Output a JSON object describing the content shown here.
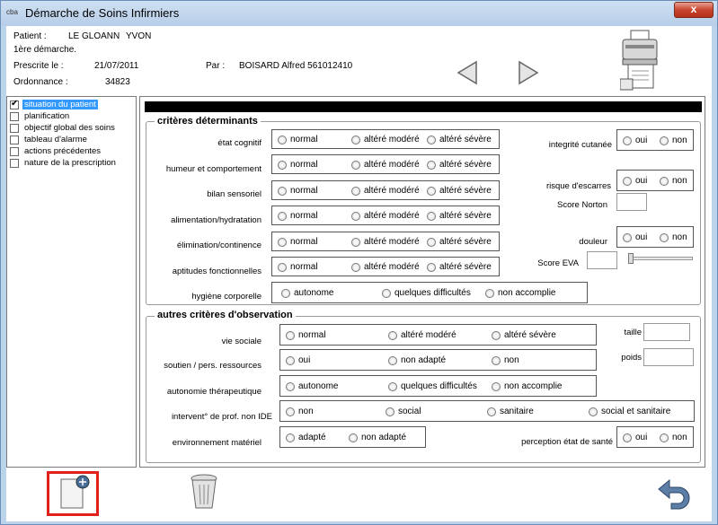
{
  "window": {
    "app_icon": "cba",
    "title": "Démarche de Soins Infirmiers",
    "close": "x"
  },
  "header": {
    "patient_label": "Patient :",
    "patient_last": "LE GLOANN",
    "patient_first": "YVON",
    "demarche": "1ère démarche.",
    "prescrite_label": "Prescrite le :",
    "prescrite_date": "21/07/2011",
    "par_label": "Par :",
    "par_value": "BOISARD Alfred 561012410",
    "ordonnance_label": "Ordonnance :",
    "ordonnance_value": "34823"
  },
  "tree": [
    {
      "label": "situation du patient",
      "checked": true,
      "selected": true
    },
    {
      "label": "planification",
      "checked": false
    },
    {
      "label": "objectif global des soins",
      "checked": false
    },
    {
      "label": "tableau d'alarme",
      "checked": false
    },
    {
      "label": "actions précédentes",
      "checked": false
    },
    {
      "label": "nature de la prescription",
      "checked": false
    }
  ],
  "criteres": {
    "legend": "critères déterminants",
    "rows": [
      {
        "label": "état cognitif",
        "options": [
          "normal",
          "altéré modéré",
          "altéré sévère"
        ]
      },
      {
        "label": "humeur et comportement",
        "options": [
          "normal",
          "altéré modéré",
          "altéré sévère"
        ]
      },
      {
        "label": "bilan sensoriel",
        "options": [
          "normal",
          "altéré modéré",
          "altéré sévère"
        ]
      },
      {
        "label": "alimentation/hydratation",
        "options": [
          "normal",
          "altéré modéré",
          "altéré sévère"
        ]
      },
      {
        "label": "élimination/continence",
        "options": [
          "normal",
          "altéré modéré",
          "altéré sévère"
        ]
      },
      {
        "label": "aptitudes fonctionnelles",
        "options": [
          "normal",
          "altéré modéré",
          "altéré sévère"
        ]
      },
      {
        "label": "hygiène corporelle",
        "options": [
          "autonome",
          "quelques difficultés",
          "non accomplie"
        ]
      }
    ],
    "integrite": {
      "label": "integrité cutanée",
      "options": [
        "oui",
        "non"
      ]
    },
    "escarres": {
      "label": "risque d'escarres",
      "options": [
        "oui",
        "non"
      ]
    },
    "norton_label": "Score Norton",
    "douleur": {
      "label": "douleur",
      "options": [
        "oui",
        "non"
      ]
    },
    "eva_label": "Score EVA"
  },
  "autres": {
    "legend": "autres critères d'observation",
    "vie_sociale": {
      "label": "vie sociale",
      "options": [
        "normal",
        "altéré modéré",
        "altéré sévère"
      ]
    },
    "soutien": {
      "label": "soutien / pers. ressources",
      "options": [
        "oui",
        "non adapté",
        "non"
      ]
    },
    "autonomie": {
      "label": "autonomie thérapeutique",
      "options": [
        "autonome",
        "quelques difficultés",
        "non accomplie"
      ]
    },
    "intervent": {
      "label": "intervent° de prof. non IDE",
      "options": [
        "non",
        "social",
        "sanitaire",
        "social et sanitaire"
      ]
    },
    "environnement": {
      "label": "environnement matériel",
      "options": [
        "adapté",
        "non adapté"
      ]
    },
    "perception": {
      "label": "perception état de santé",
      "options": [
        "oui",
        "non"
      ]
    },
    "taille_label": "taille",
    "poids_label": "poids"
  }
}
